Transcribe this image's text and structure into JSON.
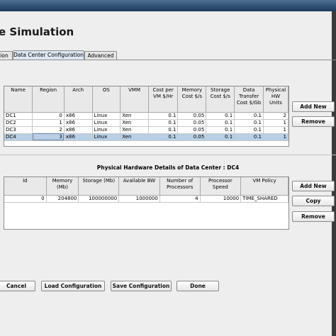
{
  "window": {
    "title": "e Simulation"
  },
  "tabs": [
    {
      "label": "ion",
      "active": false
    },
    {
      "label": "Data Center Configuration",
      "active": true
    },
    {
      "label": "Advanced",
      "active": false
    }
  ],
  "datacenters": {
    "columns": [
      "Name",
      "Region",
      "Arch",
      "OS",
      "VMM",
      "Cost per VM $/Hr",
      "Memory Cost $/s",
      "Storage Cost $/s",
      "Data Transfer Cost $/Gb",
      "Physical HW Units"
    ],
    "rows": [
      [
        "DC1",
        "0",
        "x86",
        "Linux",
        "Xen",
        "0.1",
        "0.05",
        "0.1",
        "0.1",
        "2"
      ],
      [
        "DC2",
        "1",
        "x86",
        "Linux",
        "Xen",
        "0.1",
        "0.05",
        "0.1",
        "0.1",
        "1"
      ],
      [
        "DC3",
        "2",
        "x86",
        "Linux",
        "Xen",
        "0.1",
        "0.05",
        "0.1",
        "0.1",
        "1"
      ],
      [
        "DC4",
        "3",
        "x86",
        "Linux",
        "Xen",
        "0.1",
        "0.05",
        "0.1",
        "0.1",
        "1"
      ]
    ],
    "selected_row": 3,
    "buttons": {
      "add": "Add New",
      "remove": "Remove"
    }
  },
  "hardware": {
    "title": "Physical Hardware Details of Data Center : DC4",
    "columns": [
      "Id",
      "Memory (Mb)",
      "Storage (Mb)",
      "Available BW",
      "Number of Processors",
      "Processor Speed",
      "VM Policy"
    ],
    "rows": [
      [
        "0",
        "204800",
        "100000000",
        "1000000",
        "4",
        "10000",
        "TIME_SHARED"
      ]
    ],
    "buttons": {
      "add": "Add New",
      "copy": "Copy",
      "remove": "Remove"
    }
  },
  "footer": {
    "cancel": "Cancel",
    "load": "Load Configuration",
    "save": "Save Configuration",
    "done": "Done"
  },
  "colors": {
    "selection": "#b8cfe5",
    "titlebar": "#2f4f73"
  }
}
